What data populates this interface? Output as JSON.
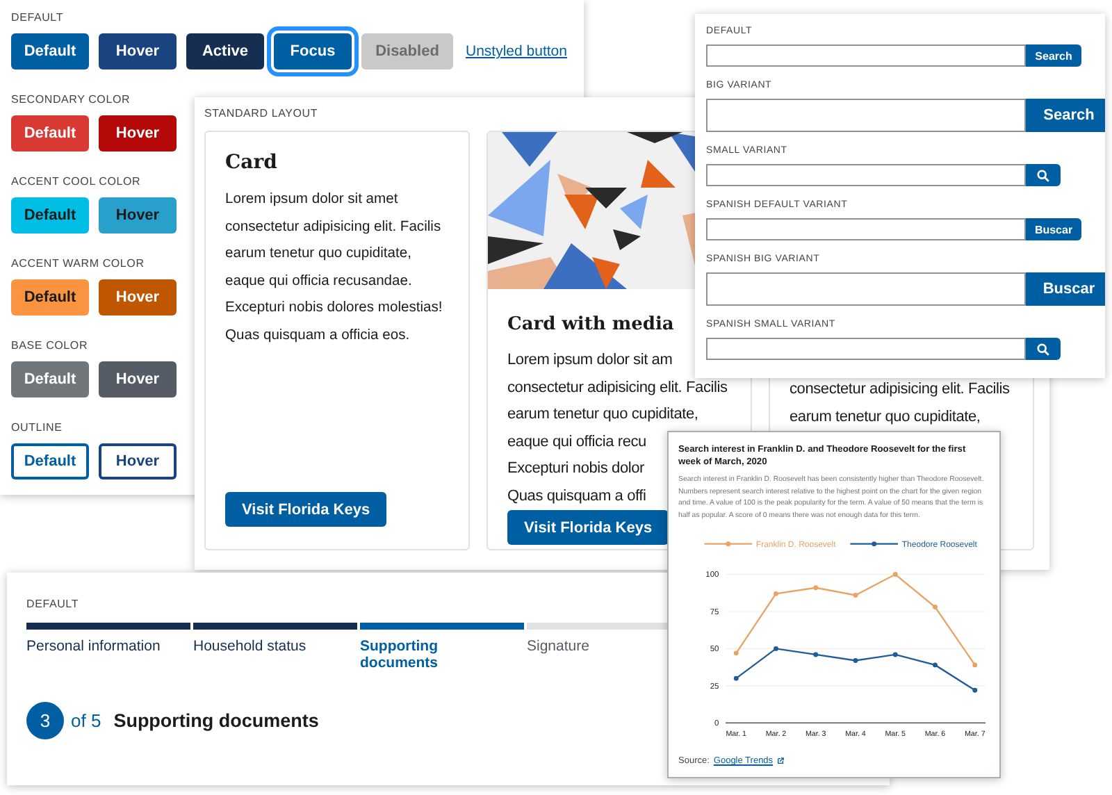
{
  "buttons_panel": {
    "sections": [
      {
        "title": "DEFAULT",
        "kind": "primary",
        "buttons": [
          {
            "label": "Default",
            "kind": "default"
          },
          {
            "label": "Hover",
            "kind": "hover"
          },
          {
            "label": "Active",
            "kind": "active"
          },
          {
            "label": "Focus",
            "kind": "focus"
          },
          {
            "label": "Disabled",
            "kind": "disabled"
          },
          {
            "label": "Unstyled button",
            "kind": "unstyled"
          }
        ]
      },
      {
        "title": "SECONDARY COLOR",
        "kind": "secondary",
        "buttons": [
          {
            "label": "Default",
            "kind": "default"
          },
          {
            "label": "Hover",
            "kind": "hover"
          }
        ]
      },
      {
        "title": "ACCENT COOL COLOR",
        "kind": "cool",
        "buttons": [
          {
            "label": "Default",
            "kind": "default"
          },
          {
            "label": "Hover",
            "kind": "hover"
          }
        ]
      },
      {
        "title": "ACCENT WARM COLOR",
        "kind": "warm",
        "buttons": [
          {
            "label": "Default",
            "kind": "default"
          },
          {
            "label": "Hover",
            "kind": "hover"
          }
        ]
      },
      {
        "title": "BASE COLOR",
        "kind": "base",
        "buttons": [
          {
            "label": "Default",
            "kind": "default"
          },
          {
            "label": "Hover",
            "kind": "hover"
          }
        ]
      },
      {
        "title": "OUTLINE",
        "kind": "outline",
        "buttons": [
          {
            "label": "Default",
            "kind": "default"
          },
          {
            "label": "Hover",
            "kind": "hover"
          }
        ]
      }
    ]
  },
  "cards_panel": {
    "title": "STANDARD LAYOUT",
    "cards": [
      {
        "kind": "text",
        "heading": "Card",
        "body": "Lorem ipsum dolor sit amet consectetur adipisicing elit. Facilis earum tenetur quo cupiditate, eaque qui officia recusandae. Excepturi nobis dolores molestias! Quas quisquam a officia eos.",
        "button": "Visit Florida Keys"
      },
      {
        "kind": "media",
        "media": {
          "kind": "picture"
        },
        "heading": "Card with media",
        "body_lines": [
          "Lorem ipsum dolor sit am",
          "consectetur adipisicing elit. Facilis",
          "earum tenetur quo cupiditate,",
          "eaque qui officia recu",
          "Excepturi nobis dolor",
          "Quas quisquam a offi"
        ],
        "button": "Visit Florida Keys"
      },
      {
        "kind": "covered",
        "body_lines": [
          "consectetur adipisicing elit. Facilis",
          "earum tenetur quo cupiditate,"
        ]
      }
    ]
  },
  "search_panel": {
    "variants": [
      {
        "label": "DEFAULT",
        "kind": "default",
        "button": "Search"
      },
      {
        "label": "BIG VARIANT",
        "kind": "big",
        "button": "Search"
      },
      {
        "label": "SMALL VARIANT",
        "kind": "small"
      },
      {
        "label": "SPANISH DEFAULT VARIANT",
        "kind": "default",
        "button": "Buscar"
      },
      {
        "label": "SPANISH BIG VARIANT",
        "kind": "big",
        "button": "Buscar"
      },
      {
        "label": "SPANISH SMALL VARIANT",
        "kind": "small"
      }
    ]
  },
  "step_panel": {
    "label": "DEFAULT",
    "steps": [
      {
        "label": "Personal information",
        "kind": "complete"
      },
      {
        "label": "Household status",
        "kind": "complete"
      },
      {
        "label": "Supporting documents",
        "kind": "current"
      },
      {
        "label": "Signature",
        "kind": "incomplete"
      }
    ],
    "counter": {
      "current": "3",
      "total": "of 5",
      "heading": "Supporting documents"
    }
  },
  "chart_panel": {
    "title": "Search interest in Franklin D. and Theodore Roosevelt for the first week of March, 2020",
    "description": "Search interest in Franklin D. Roosevelt has been consistently higher than Theodore Roosevelt. Numbers represent search interest relative to the highest point on the chart for the given region and time. A value of 100 is the peak popularity for the term. A value of 50 means that the term is half as popular. A score of 0 means there was not enough data for this term.",
    "chart_data": {
      "type": "line",
      "categories": [
        "Mar. 1",
        "Mar. 2",
        "Mar. 3",
        "Mar. 4",
        "Mar. 5",
        "Mar. 6",
        "Mar. 7"
      ],
      "series": [
        {
          "name": "Franklin D. Roosevelt",
          "color": "#e8a363",
          "marker": true,
          "values": [
            47,
            87,
            91,
            86,
            100,
            78,
            39
          ]
        },
        {
          "name": "Theodore Roosevelt",
          "color": "#1f5c99",
          "marker": true,
          "values": [
            30,
            50,
            46,
            42,
            46,
            39,
            22
          ]
        }
      ],
      "ylim": [
        0,
        100
      ],
      "yticks": [
        0,
        25,
        50,
        75,
        100
      ],
      "grid": true
    },
    "source_label": "Source:",
    "source_link": "Google Trends"
  }
}
